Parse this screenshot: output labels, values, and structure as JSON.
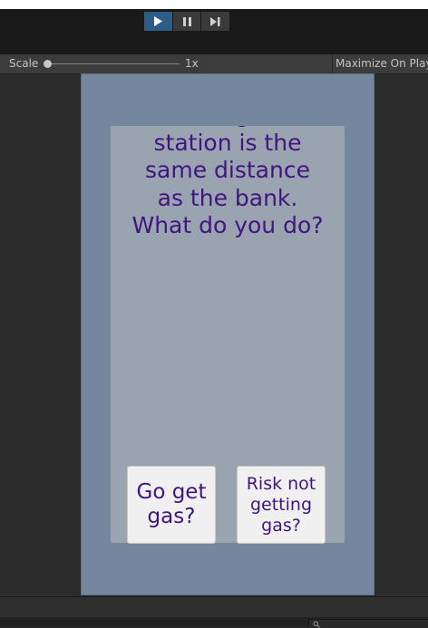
{
  "toolbar": {
    "play_controls": [
      {
        "name": "play",
        "icon": "play-icon",
        "active": true
      },
      {
        "name": "pause",
        "icon": "pause-icon",
        "active": false
      },
      {
        "name": "step",
        "icon": "step-icon",
        "active": false
      }
    ]
  },
  "game_view_bar": {
    "scale_label": "Scale",
    "scale_value": "1x",
    "maximize_label": "Maximize On Play"
  },
  "game": {
    "story_text": "Your gas\nstation is the\nsame distance\nas the bank.\nWhat do you do?",
    "choices": [
      {
        "label": "Go get\ngas?"
      },
      {
        "label": "Risk not\ngetting\ngas?"
      }
    ]
  },
  "colors": {
    "editor_background": "#282828",
    "toolbar_background": "#191919",
    "active_play_button": "#2c5d87",
    "game_background": "#74879f",
    "panel_background": "#9aa4b1",
    "story_text": "#40157f",
    "button_background": "#f0f0f0"
  },
  "search": {
    "icon": "search-icon"
  }
}
